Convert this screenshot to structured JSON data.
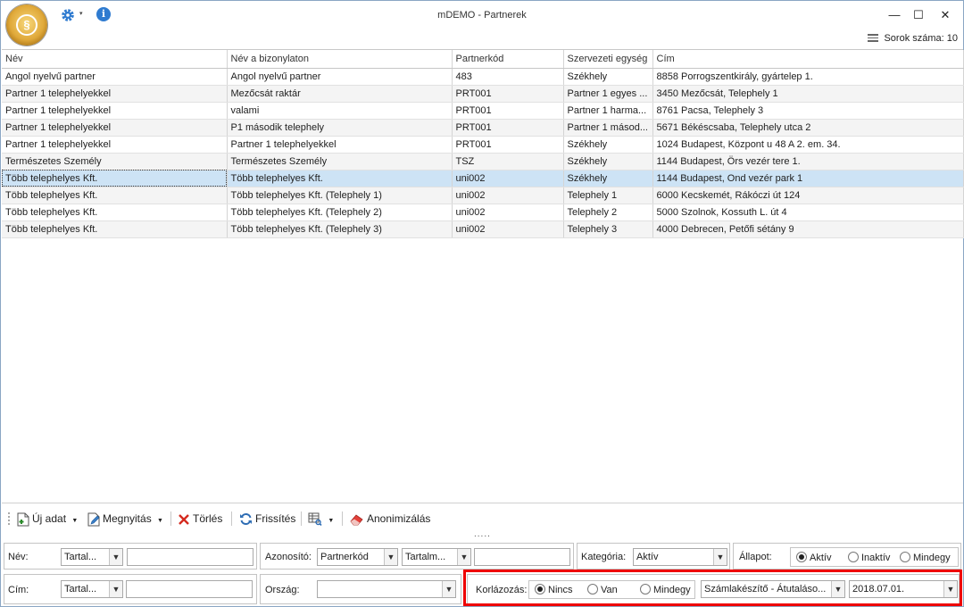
{
  "window": {
    "title": "mDEMO - Partnerek",
    "row_count_label": "Sorok száma: 10",
    "minimize": "—",
    "maximize": "☐",
    "close": "✕"
  },
  "quick_access": {
    "info_glyph": "i",
    "dropdown_glyph": "▾"
  },
  "grid": {
    "columns": [
      "Név",
      "Név a bizonylaton",
      "Partnerkód",
      "Szervezeti egység",
      "Cím"
    ],
    "rows": [
      [
        "Angol nyelvű partner",
        "Angol nyelvű partner",
        "483",
        "Székhely",
        "8858 Porrogszentkirály, gyártelep 1."
      ],
      [
        "Partner 1 telephelyekkel",
        "Mezőcsát raktár",
        "PRT001",
        "Partner 1 egyes ...",
        "3450 Mezőcsát, Telephely 1"
      ],
      [
        "Partner 1 telephelyekkel",
        "valami",
        "PRT001",
        "Partner 1 harma...",
        "8761 Pacsa, Telephely 3"
      ],
      [
        "Partner 1 telephelyekkel",
        "P1 második telephely",
        "PRT001",
        "Partner 1 másod...",
        "5671 Békéscsaba, Telephely utca 2"
      ],
      [
        "Partner 1 telephelyekkel",
        "Partner 1 telephelyekkel",
        "PRT001",
        "Székhely",
        "1024 Budapest, Központ u 48 A 2. em. 34."
      ],
      [
        "Természetes Személy",
        "Természetes Személy",
        "TSZ",
        "Székhely",
        "1144 Budapest, Örs vezér tere 1."
      ],
      [
        "Több telephelyes Kft.",
        "Több telephelyes Kft.",
        "uni002",
        "Székhely",
        "1144 Budapest, Ond vezér park 1"
      ],
      [
        "Több telephelyes Kft.",
        "Több telephelyes Kft. (Telephely 1)",
        "uni002",
        "Telephely 1",
        "6000 Kecskemét, Rákóczi út 124"
      ],
      [
        "Több telephelyes Kft.",
        "Több telephelyes Kft. (Telephely 2)",
        "uni002",
        "Telephely 2",
        "5000 Szolnok, Kossuth L. út 4"
      ],
      [
        "Több telephelyes Kft.",
        "Több telephelyes Kft. (Telephely 3)",
        "uni002",
        "Telephely 3",
        "4000 Debrecen, Petőfi sétány 9"
      ]
    ],
    "selected_row": 6
  },
  "toolbar": {
    "new": "Új adat",
    "open": "Megnyitás",
    "delete": "Törlés",
    "refresh": "Frissítés",
    "anonymize": "Anonimizálás",
    "dots": "....."
  },
  "filters": {
    "name": {
      "label": "Név:",
      "mode": "Tartal...",
      "value": ""
    },
    "address": {
      "label": "Cím:",
      "mode": "Tartal...",
      "value": ""
    },
    "id": {
      "label": "Azonosító:",
      "field": "Partnerkód",
      "mode": "Tartalm...",
      "value": ""
    },
    "country": {
      "label": "Ország:",
      "value": ""
    },
    "category": {
      "label": "Kategória:",
      "value": "Aktív"
    },
    "status": {
      "label": "Állapot:",
      "options": [
        "Aktív",
        "Inaktív",
        "Mindegy"
      ],
      "selected": 0
    },
    "restriction": {
      "label": "Korlázozás:",
      "options": [
        "Nincs",
        "Van",
        "Mindegy"
      ],
      "selected": 0,
      "combo": "Számlakészítő - Átutaláso...",
      "date": "2018.07.01."
    }
  },
  "colors": {
    "selection": "#cde3f5",
    "highlight": "#ee0000",
    "accent": "#2f7bd0"
  }
}
